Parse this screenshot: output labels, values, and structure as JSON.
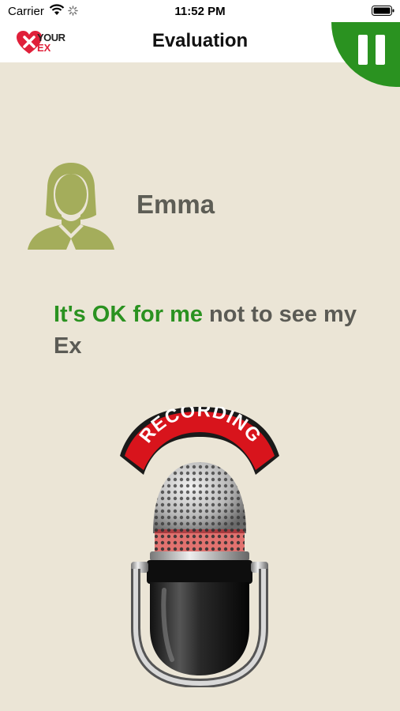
{
  "status_bar": {
    "carrier": "Carrier",
    "time": "11:52 PM"
  },
  "nav": {
    "title": "Evaluation",
    "logo_line1": "YOUR",
    "logo_line2": "EX"
  },
  "profile": {
    "name": "Emma"
  },
  "phrase": {
    "highlight": "It's OK for me",
    "rest": " not to see my Ex"
  },
  "recording": {
    "label": "RECORDING"
  },
  "colors": {
    "accent_green": "#2a9220",
    "background": "#ebe5d6",
    "avatar_green": "#a4ad5b",
    "record_red": "#d8141c"
  }
}
